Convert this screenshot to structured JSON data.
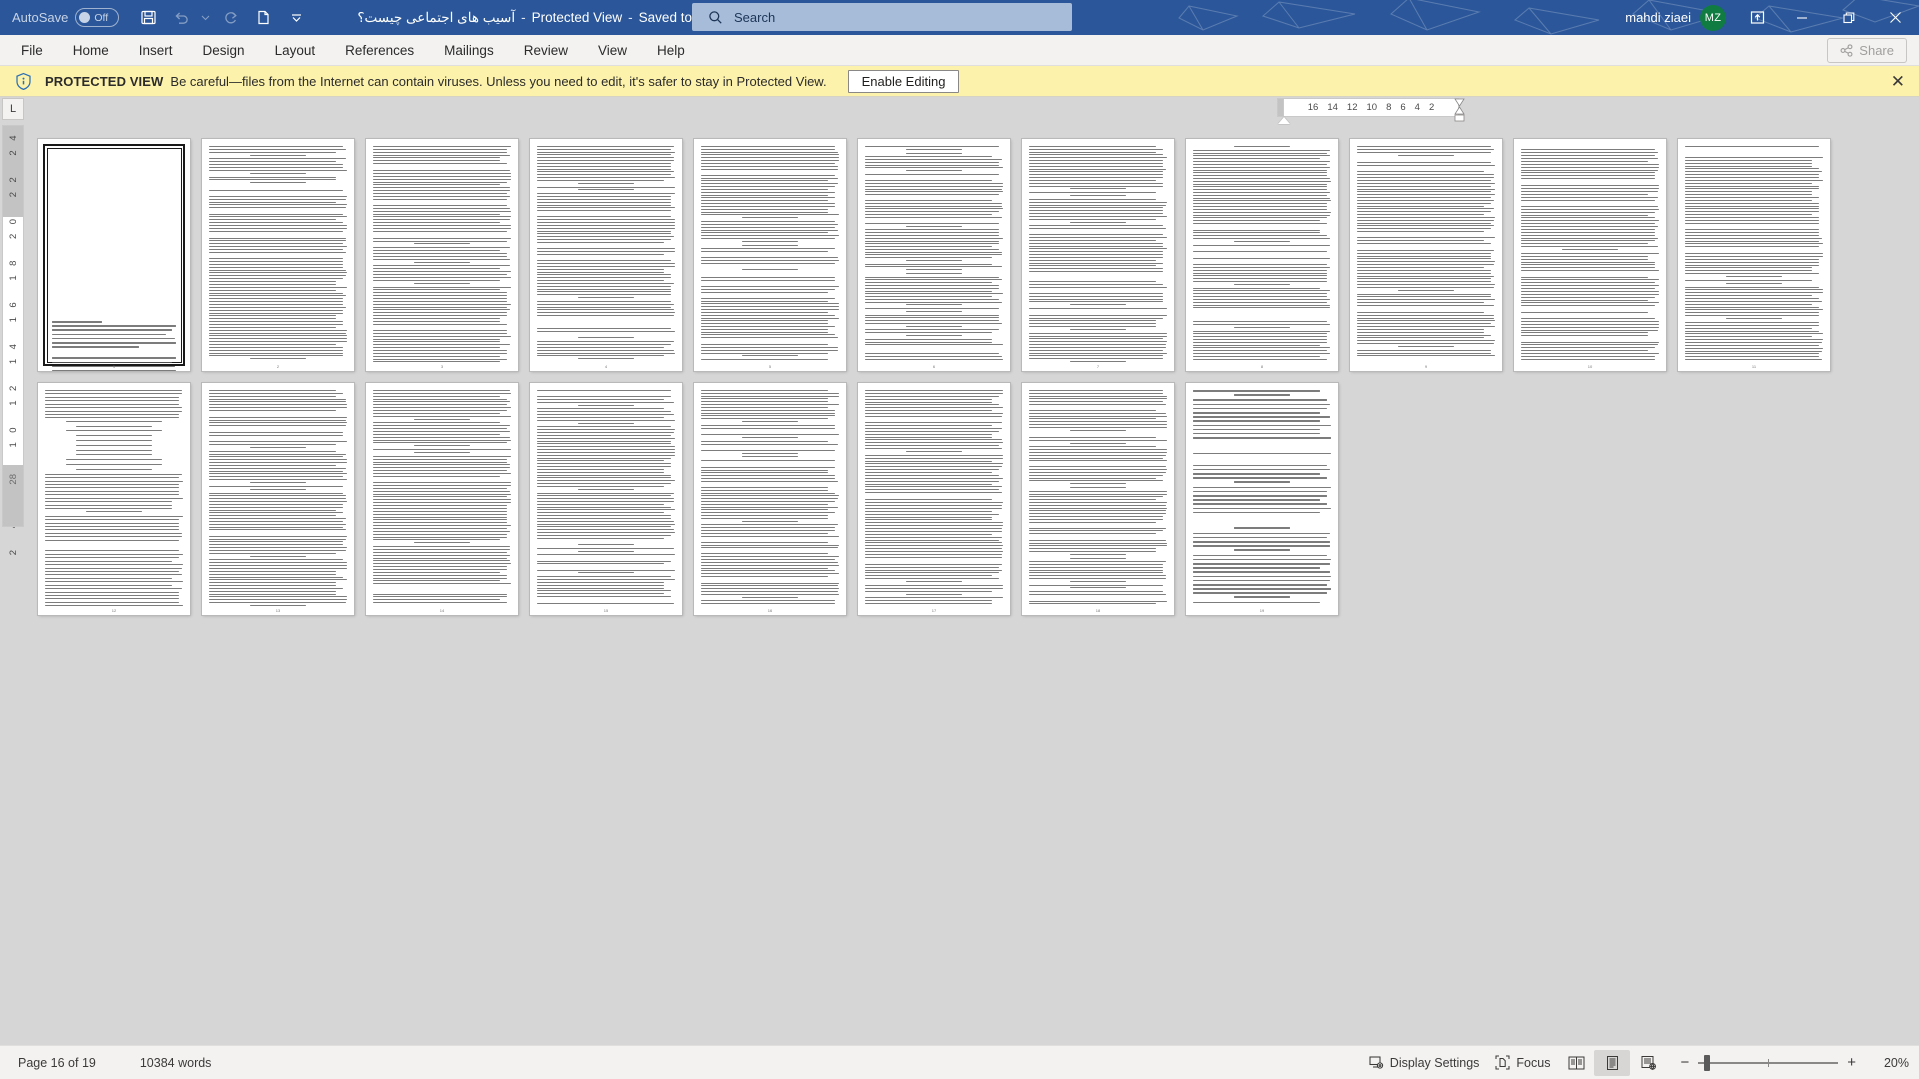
{
  "titlebar": {
    "autosave_label": "AutoSave",
    "autosave_state": "Off",
    "qat": [
      {
        "name": "save-button",
        "icon": "save-icon"
      },
      {
        "name": "undo-button",
        "icon": "undo-icon"
      },
      {
        "name": "undo-dropdown",
        "icon": "chevron-down-icon"
      },
      {
        "name": "redo-button",
        "icon": "redo-icon"
      },
      {
        "name": "new-document-button",
        "icon": "document-icon"
      },
      {
        "name": "customize-qat-button",
        "icon": "chevron-down-bar-icon"
      }
    ],
    "doc_name": "آسیب های اجتماعی چیست؟",
    "separator": "-",
    "protected_view": "Protected View",
    "saved_state": "Saved to this PC",
    "search_placeholder": "Search",
    "search_icon": "search-icon",
    "account_name": "mahdi ziaei",
    "account_initials": "MZ",
    "ribbon_display_icon": "ribbon-display-options-icon",
    "minimize_icon": "minimize-icon",
    "restore_icon": "restore-icon",
    "close_icon": "close-icon",
    "brand_color": "#2b579a",
    "avatar_color": "#107c41"
  },
  "ribbon": {
    "tabs": [
      {
        "label": "File"
      },
      {
        "label": "Home"
      },
      {
        "label": "Insert"
      },
      {
        "label": "Design"
      },
      {
        "label": "Layout"
      },
      {
        "label": "References"
      },
      {
        "label": "Mailings"
      },
      {
        "label": "Review"
      },
      {
        "label": "View"
      },
      {
        "label": "Help"
      }
    ],
    "share_label": "Share",
    "share_icon": "share-icon"
  },
  "protected_view_bar": {
    "icon": "shield-info-icon",
    "strong": "PROTECTED VIEW",
    "message": "Be careful—files from the Internet can contain viruses. Unless you need to edit, it's safer to stay in Protected View.",
    "button_label": "Enable Editing",
    "close_icon": "close-icon",
    "background": "#fdf2ab"
  },
  "ruler": {
    "corner_tab_label": "L",
    "horizontal_ticks": [
      "16",
      "14",
      "12",
      "10",
      "8",
      "6",
      "4",
      "2"
    ],
    "vertical_ticks": [
      "2",
      "4",
      "6",
      "8",
      "10",
      "12",
      "14",
      "16",
      "18",
      "20",
      "22",
      "24"
    ],
    "vertical_gray_tick": "28"
  },
  "document": {
    "zoom_level": "20%",
    "page_count": 19,
    "pages": [
      {
        "n": 1,
        "type": "title"
      },
      {
        "n": 2,
        "type": "text"
      },
      {
        "n": 3,
        "type": "text"
      },
      {
        "n": 4,
        "type": "text"
      },
      {
        "n": 5,
        "type": "text"
      },
      {
        "n": 6,
        "type": "text"
      },
      {
        "n": 7,
        "type": "text"
      },
      {
        "n": 8,
        "type": "text"
      },
      {
        "n": 9,
        "type": "text"
      },
      {
        "n": 10,
        "type": "text"
      },
      {
        "n": 11,
        "type": "text"
      },
      {
        "n": 12,
        "type": "list"
      },
      {
        "n": 13,
        "type": "text"
      },
      {
        "n": 14,
        "type": "text"
      },
      {
        "n": 15,
        "type": "text"
      },
      {
        "n": 16,
        "type": "text"
      },
      {
        "n": 17,
        "type": "text"
      },
      {
        "n": 18,
        "type": "text"
      },
      {
        "n": 19,
        "type": "short"
      }
    ],
    "title_page": {
      "line1": "به نام خدا",
      "line2": "موضوع :",
      "line3": "آسیب های اجتماعی چیست؟",
      "line4": "انواع آسیبهای اجتماعی و علل و عوامل پیدایش آسیب های اجتماعی و راههای پیشگیری از آن",
      "heading": "مقدمه :"
    }
  },
  "statusbar": {
    "page_indicator": "Page 16 of 19",
    "word_count": "10384 words",
    "display_settings_label": "Display Settings",
    "display_settings_icon": "display-settings-icon",
    "focus_label": "Focus",
    "focus_icon": "focus-icon",
    "views": [
      {
        "name": "read-mode-view-button",
        "icon": "read-mode-icon",
        "active": false
      },
      {
        "name": "print-layout-view-button",
        "icon": "print-layout-icon",
        "active": true
      },
      {
        "name": "web-layout-view-button",
        "icon": "web-layout-icon",
        "active": false
      }
    ],
    "zoom_out_label": "−",
    "zoom_in_label": "+",
    "zoom_percent": "20%"
  }
}
